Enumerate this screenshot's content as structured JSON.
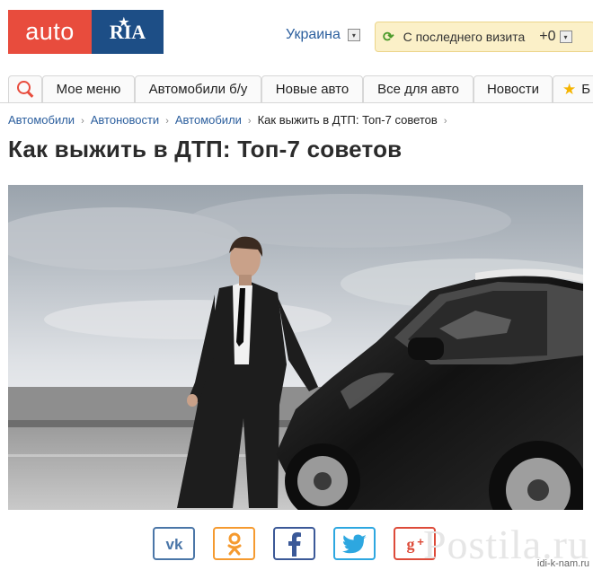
{
  "header": {
    "logo_left": "auto",
    "logo_right": "RIA",
    "region": "Украина",
    "visit_label": "С последнего визита",
    "visit_count": "+0"
  },
  "nav": {
    "items": [
      {
        "label": "Мое меню"
      },
      {
        "label": "Автомобили б/у"
      },
      {
        "label": "Новые авто"
      },
      {
        "label": "Все для авто"
      },
      {
        "label": "Новости"
      },
      {
        "label": "Б"
      }
    ]
  },
  "breadcrumbs": [
    "Автомобили",
    "Автоновости",
    "Автомобили",
    "Как выжить в ДТП: Топ-7 советов"
  ],
  "article": {
    "title": "Как выжить в ДТП: Топ-7 советов"
  },
  "share": [
    {
      "icon": "vk-icon",
      "color": "#4a76a8"
    },
    {
      "icon": "odnoklassniki-icon",
      "color": "#f59a2f"
    },
    {
      "icon": "facebook-icon",
      "color": "#3b5998"
    },
    {
      "icon": "twitter-icon",
      "color": "#2da7e0"
    },
    {
      "icon": "google-plus-icon",
      "color": "#dd4b39"
    }
  ],
  "watermark": {
    "brand": "Postila.ru",
    "url": "idi-k-nam.ru"
  },
  "colors": {
    "brand_red": "#e84c3d",
    "brand_blue": "#1d4e86",
    "link": "#2c5f9e"
  }
}
